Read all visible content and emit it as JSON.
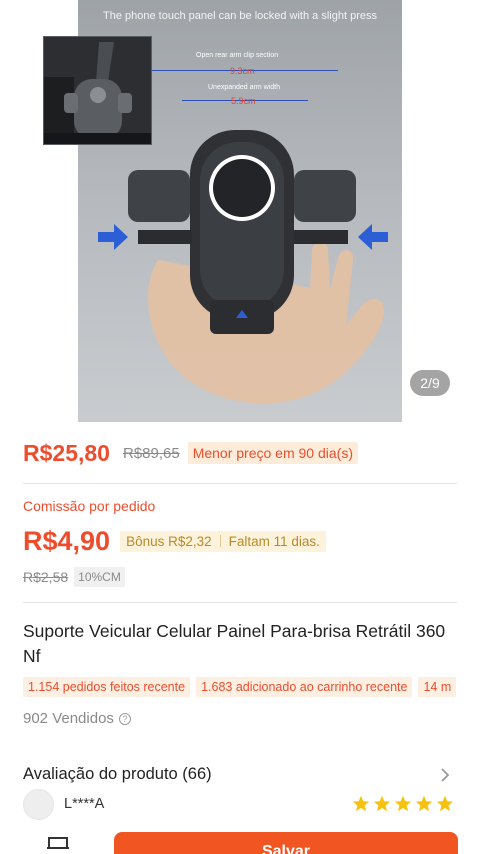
{
  "gallery": {
    "caption": "The phone touch panel can be locked with a slight press",
    "label_open_arm": "Open rear arm clip section",
    "label_open_arm_value": "9.3cm",
    "label_unexpanded_arm": "Unexpanded arm width",
    "label_unexpanded_arm_value": "5.9cm",
    "page_indicator": "2/9"
  },
  "price": {
    "current": "R$25,80",
    "original": "R$89,65",
    "lowest_tag": "Menor preço em 90 dia(s)"
  },
  "commission": {
    "label": "Comissão por pedido",
    "amount": "R$4,90",
    "bonus": "Bônus R$2,32",
    "days_left": "Faltam 11 dias.",
    "old_amount": "R$2,58",
    "rate": "10%CM"
  },
  "product": {
    "title": "Suporte Veicular Celular Painel Para-brisa Retrátil 360 Nf",
    "badges": [
      "1.154 pedidos feitos recente",
      "1.683 adicionado ao carrinho recente",
      "14 m"
    ],
    "sold": "902 Vendidos",
    "help_glyph": "?"
  },
  "reviews": {
    "title": "Avaliação do produto (66)",
    "reviewer_name": "L****A",
    "rating": 5
  },
  "bottom_bar": {
    "store_icon": "store-icon",
    "primary_button": "Salvar"
  },
  "colors": {
    "accent": "#ee4d2d",
    "button": "#f05522",
    "star": "#f6c10f"
  }
}
